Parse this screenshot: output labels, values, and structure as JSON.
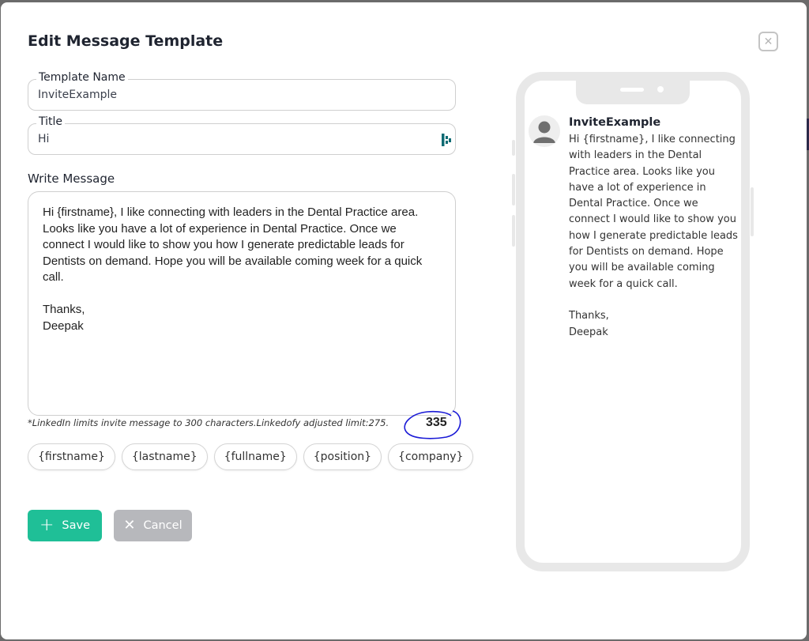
{
  "modal": {
    "title": "Edit Message Template",
    "close_icon": "close-icon"
  },
  "form": {
    "template_name": {
      "label": "Template Name",
      "value": "InviteExample"
    },
    "title": {
      "label": "Title",
      "value": "Hi",
      "icon": "linkedofy-logo-icon"
    },
    "message": {
      "label": "Write Message",
      "value": "Hi {firstname}, I like connecting with leaders in the Dental Practice area. Looks like you have a lot of experience in Dental Practice. Once we connect I would like to show you how I generate predictable leads for Dentists on demand. Hope you will be available coming week for a quick call.\n\nThanks,\nDeepak"
    },
    "limit_note": "*LinkedIn limits invite message to 300 characters.Linkedofy adjusted limit:275.",
    "char_count": "335",
    "annotation_color": "#1a1ad6"
  },
  "placeholders": [
    "{firstname}",
    "{lastname}",
    "{fullname}",
    "{position}",
    "{company}"
  ],
  "buttons": {
    "save": {
      "label": "Save",
      "icon": "plus-icon",
      "color": "#1fbf97"
    },
    "cancel": {
      "label": "Cancel",
      "icon": "x-icon",
      "color": "#b7b8bc"
    }
  },
  "preview": {
    "name": "InviteExample",
    "avatar_icon": "user-avatar-icon",
    "message": "Hi {firstname}, I like connecting with leaders in the Dental Practice area. Looks like you have a lot of experience in Dental Practice. Once we connect I would like to show you how I generate predictable leads for Dentists on demand. Hope you will be available coming week for a quick call.\n\nThanks,\nDeepak"
  }
}
